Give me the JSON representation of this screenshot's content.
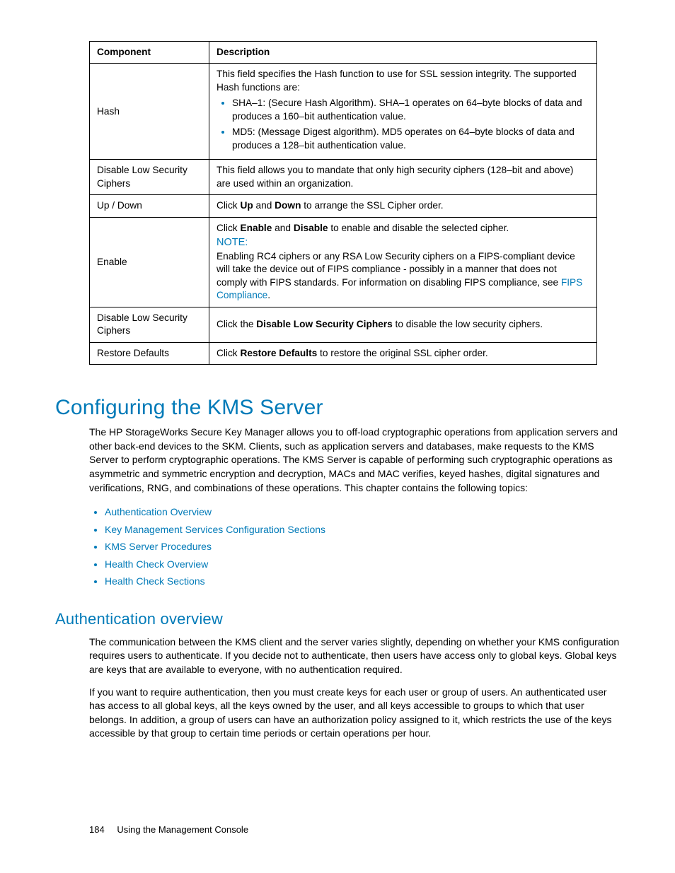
{
  "table": {
    "headers": {
      "component": "Component",
      "description": "Description"
    },
    "rows": {
      "hash": {
        "component": "Hash",
        "intro": "This field specifies the Hash function to use for SSL session integrity. The supported Hash functions are:",
        "bullets": [
          "SHA–1: (Secure Hash Algorithm). SHA–1 operates on 64–byte blocks of data and produces a 160–bit authentication value.",
          "MD5: (Message Digest algorithm). MD5 operates on 64–byte blocks of data and produces a 128–bit authentication value."
        ]
      },
      "disable1": {
        "component": "Disable Low Security Ciphers",
        "desc": "This field allows you to mandate that only high security ciphers (128–bit and above) are used within an organization."
      },
      "updown": {
        "component": "Up / Down",
        "pre": "Click ",
        "b1": "Up",
        "mid": " and ",
        "b2": "Down",
        "post": " to arrange the SSL Cipher order."
      },
      "enable": {
        "component": "Enable",
        "line1_pre": "Click ",
        "line1_b1": "Enable",
        "line1_mid": " and ",
        "line1_b2": "Disable",
        "line1_post": " to enable and disable the selected cipher.",
        "note_label": "NOTE:",
        "note_body_pre": "Enabling RC4 ciphers or any RSA Low Security ciphers on a FIPS-compliant device will take the device out of FIPS compliance - possibly in a manner that does not comply with FIPS standards. For information on disabling FIPS compliance, see ",
        "note_link": "FIPS Compliance",
        "note_body_post": "."
      },
      "disable2": {
        "component": "Disable Low Security Ciphers",
        "pre": "Click the ",
        "b": "Disable Low Security Ciphers",
        "post": " to disable the low security ciphers."
      },
      "restore": {
        "component": "Restore Defaults",
        "pre": "Click ",
        "b": "Restore Defaults",
        "post": " to restore the original SSL cipher order."
      }
    }
  },
  "section": {
    "title": "Configuring the KMS Server",
    "intro": "The HP StorageWorks Secure Key Manager allows you to off-load cryptographic operations from application servers and other back-end devices to the SKM. Clients, such as application servers and databases, make requests to the KMS Server to perform cryptographic operations. The KMS Server is capable of performing such cryptographic operations as asymmetric and symmetric encryption and decryption, MACs and MAC verifies, keyed hashes, digital signatures and verifications, RNG, and combinations of these operations. This chapter contains the following topics:",
    "topics": [
      "Authentication Overview",
      "Key Management Services Configuration Sections",
      "KMS Server Procedures",
      "Health Check Overview",
      "Health Check Sections"
    ]
  },
  "subsection": {
    "title": "Authentication overview",
    "p1": "The communication between the KMS client and the server varies slightly, depending on whether your KMS configuration requires users to authenticate. If you decide not to authenticate, then users have access only to global keys. Global keys are keys that are available to everyone, with no authentication required.",
    "p2": "If you want to require authentication, then you must create keys for each user or group of users. An authenticated user has access to all global keys, all the keys owned by the user, and all keys accessible to groups to which that user belongs. In addition, a group of users can have an authorization policy assigned to it, which restricts the use of the keys accessible by that group to certain time periods or certain operations per hour."
  },
  "footer": {
    "page": "184",
    "section": "Using the Management Console"
  }
}
